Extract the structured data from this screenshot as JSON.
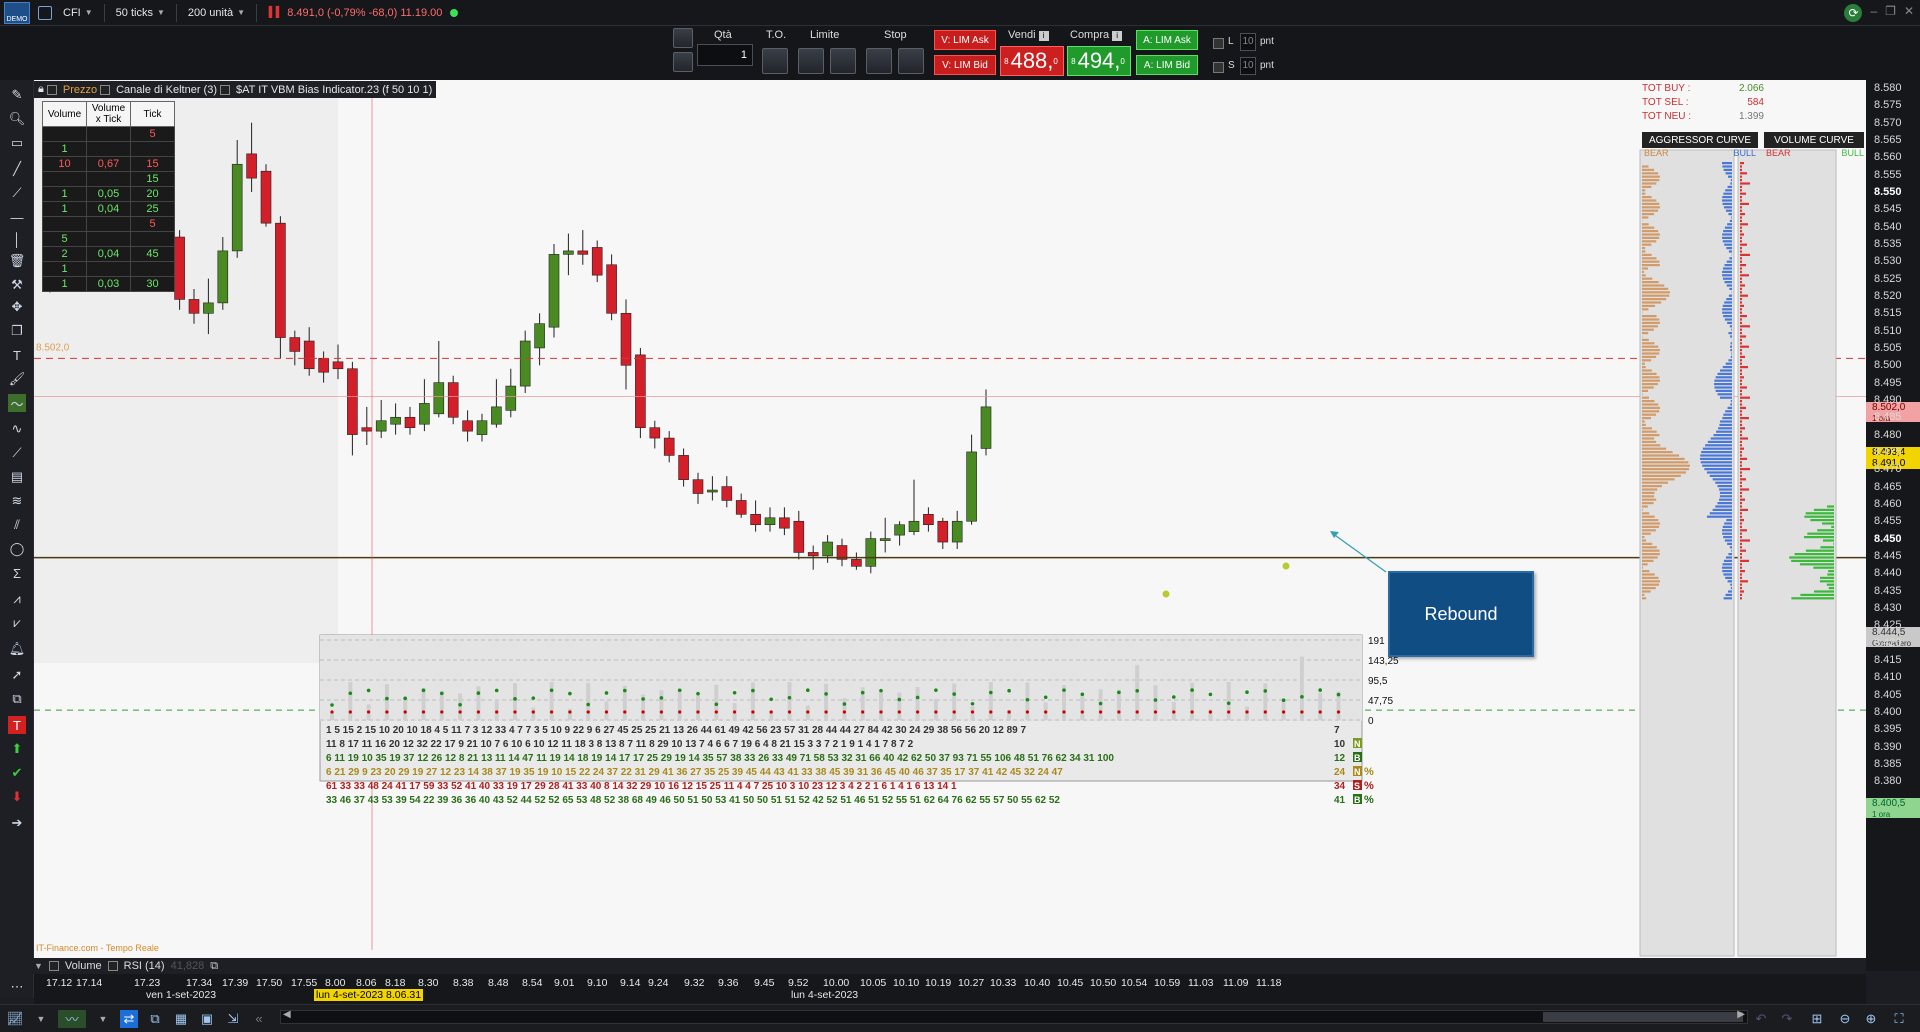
{
  "topbar": {
    "instrument": "CFI",
    "ticks": "50 ticks",
    "units": "200 unità",
    "quote": "8.491,0 (-0,79% -68,0) 11.19.00",
    "app_tag": "DEMO"
  },
  "order": {
    "qty_label": "Qtà",
    "to_label": "T.O.",
    "limite_label": "Limite",
    "stop_label": "Stop",
    "qty_value": "1",
    "v_lim_ask": "V: LIM Ask",
    "v_lim_bid": "V: LIM Bid",
    "vendi_label": "Vendi",
    "compra_label": "Compra",
    "a_lim_ask": "A: LIM Ask",
    "a_lim_bid": "A: LIM Bid",
    "sell_prefix": "8",
    "sell_price": "488,",
    "sell_decimal": "0",
    "buy_prefix": "8",
    "buy_price": "494,",
    "buy_decimal": "0",
    "l_label": "L",
    "s_label": "S",
    "l_value": "10",
    "s_value": "10",
    "pnt": "pnt"
  },
  "legend": {
    "price": "Prezzo",
    "keltner": "Canale di Keltner (3)",
    "indicator": "$AT IT VBM Bias Indicator.23 (f 50 10 1)"
  },
  "vtable": {
    "headers": [
      "Volume",
      "Volume x Tick",
      "Tick"
    ],
    "rows": [
      [
        "",
        "",
        "5"
      ],
      [
        "1",
        "",
        ""
      ],
      [
        "10",
        "0,67",
        "15"
      ],
      [
        "",
        "",
        "15"
      ],
      [
        "1",
        "0,05",
        "20"
      ],
      [
        "1",
        "0,04",
        "25"
      ],
      [
        "",
        "",
        "5"
      ],
      [
        "5",
        "",
        ""
      ],
      [
        "2",
        "0,04",
        "45"
      ],
      [
        "1",
        "",
        ""
      ],
      [
        "1",
        "0,03",
        "30"
      ]
    ]
  },
  "annotation": {
    "rebound": "Rebound"
  },
  "totals": {
    "buy_label": "TOT BUY :",
    "buy_value": "2.066",
    "sel_label": "TOT SEL :",
    "sel_value": "584",
    "neu_label": "TOT NEU :",
    "neu_value": "1.399"
  },
  "curves": {
    "aggressor": "AGGRESSOR CURVE",
    "volume": "VOLUME CURVE",
    "bear": "BEAR",
    "bull": "BULL"
  },
  "price_axis": {
    "labels": [
      "8.580",
      "8.575",
      "8.570",
      "8.565",
      "8.560",
      "8.555",
      "8.550",
      "8.545",
      "8.540",
      "8.535",
      "8.530",
      "8.525",
      "8.520",
      "8.515",
      "8.510",
      "8.505",
      "8.500",
      "8.495",
      "8.490",
      "8.485",
      "8.480",
      "8.475",
      "8.470",
      "8.465",
      "8.460",
      "8.455",
      "8.450",
      "8.445",
      "8.440",
      "8.435",
      "8.430",
      "8.425",
      "8.420",
      "8.415",
      "8.410",
      "8.405",
      "8.400",
      "8.395",
      "8.390",
      "8.385",
      "8.380"
    ],
    "bold_labels": [
      "8.550",
      "8.450"
    ],
    "tag_red": "8.502,0",
    "tag_red_sub": "1 ora",
    "tag_yellow": "8.493,4",
    "tag_price": "8.491,0",
    "tag_gray": "8.444,5",
    "tag_gray_sub": "Giornaliero",
    "tag_green": "8.400,5",
    "tag_green_sub": "1 ora",
    "level_label": "8.502,0"
  },
  "volume_panel": {
    "scale": [
      "191",
      "143,25",
      "95,5",
      "47,75",
      "0"
    ],
    "rows": [
      {
        "color": "#333",
        "values": "1  5 15  2 15 10 20 10 18  4  5 11  7  3 12 33  4  7  7  3  5 10  9 22  9  6 27 45 25 25 21 13 26 44 61 49 42 56 23 57 31 28 44 44 27 84 42 30 24 29 38 56 56 20 12 89  7",
        "tail": "7"
      },
      {
        "color": "#333",
        "values": "11  8 17 11 16 20 12 32 22 17  9 21 10  7  6 10  6    10 12 11 18  3  8 13  8  7 11  8 29 10 13  7  4  6  6  7 19  6  4  8 21 15  3  3  7  2  1  9  1  4  1  7  8  7  2",
        "tail": "10"
      },
      {
        "color": "#2a6e17",
        "values": "6 11 19 10 35 19 37 12 26 12  8 21 13 11 14 47 11 19 14 18 19 14 17 17 25 29 19 14 35 57 38 33 26 33 49 71 58 53 32 31 66 40 42 62 50 37 93 71 55 106 48 51 76 62 34 31 100",
        "tail": "12"
      },
      {
        "color": "#a88a1a",
        "values": "6 21 29  9 23 20 29 19 27 12 23 14 38 37 19 35 19 10 15 22 24 37 22 31 29 41 36 27 35 25 39 45 44 43 41 33 38 45 39 31 36 45 40 46 37 35 17 37 41 42 45 32 24 47",
        "tail": "24"
      },
      {
        "color": "#b02020",
        "values": "61 33 33 48 24 41 17 59 33 52 41 40 33 19 17 29    28 41 33 40  8 14 32 29 10 16 12 15 25 11  4  4  7 25 10  3 10 23 12  3  4  2  2  1  6  1  4  1  6 13 14  1",
        "tail": "34"
      },
      {
        "color": "#2a6e17",
        "values": "33 46 37 43 53 39 54 22 39 36 36 40 43 52 44 52 52 65 53 48 52 38 68 49 46 50 51 50 53 41 50 50 51 51 52 42 52 51 46 51 52 55 51 62 64 76 62 55 57 50 55 62 52",
        "tail": "41"
      }
    ],
    "row_tags": [
      "N",
      "B",
      "N",
      "S",
      "B"
    ],
    "row_tag_pct": [
      "",
      "",
      "%",
      "%",
      "%"
    ]
  },
  "bottom_tabs": {
    "volume": "Volume",
    "rsi": "RSI (14)",
    "rsi_value": "41,828"
  },
  "time_axis": {
    "times": [
      "17.12",
      "17.14",
      "17.23",
      "17.34",
      "17.39",
      "17.50",
      "17.55",
      "8.00",
      "8.06",
      "8.18",
      "8.30",
      "8.38",
      "8.48",
      "8.54",
      "9.01",
      "9.10",
      "9.14",
      "9.24",
      "9.32",
      "9.36",
      "9.45",
      "9.52",
      "10.00",
      "10.05",
      "10.10",
      "10.19",
      "10.27",
      "10.33",
      "10.40",
      "10.45",
      "10.50",
      "10.54",
      "10.59",
      "11.03",
      "11.09",
      "11.18"
    ],
    "date_1": "ven 1-set-2023",
    "date_hl": "lun 4-set-2023 8.06.31",
    "date_2": "lun 4-set-2023"
  },
  "provider": "IT-Finance.com - Tempo Reale",
  "colors": {
    "bull": "#4a8a22",
    "bear": "#d21f2a",
    "accent": "#0f4d82"
  }
}
